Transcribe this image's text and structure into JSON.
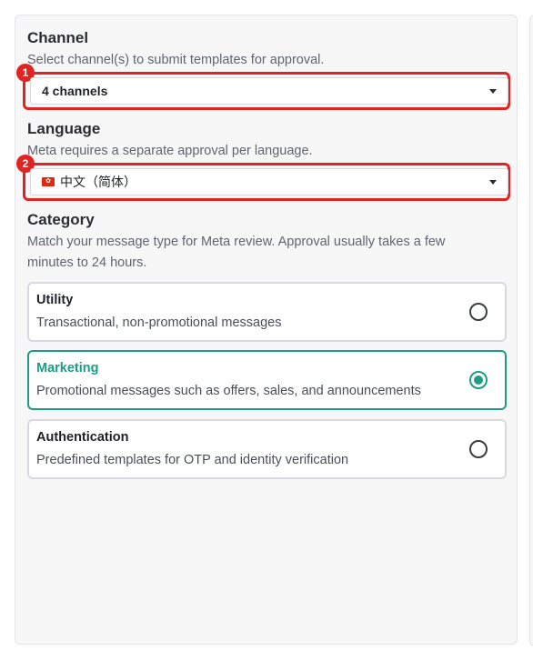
{
  "channel": {
    "title": "Channel",
    "description": "Select channel(s) to submit templates for approval.",
    "selected": "4 channels",
    "annotation": "1"
  },
  "language": {
    "title": "Language",
    "description": "Meta requires a separate approval per language.",
    "selected": "中文（简体）",
    "flag": "flag-icon",
    "annotation": "2"
  },
  "category": {
    "title": "Category",
    "description_line1": "Match your message type for Meta review. Approval usually takes a few",
    "description_line2": "minutes to 24 hours.",
    "options": [
      {
        "title": "Utility",
        "description": "Transactional, non-promotional messages",
        "selected": false
      },
      {
        "title": "Marketing",
        "description": "Promotional messages such as offers, sales, and announcements",
        "selected": true
      },
      {
        "title": "Authentication",
        "description": "Predefined templates for OTP and identity verification",
        "selected": false
      }
    ]
  },
  "colors": {
    "accent": "#1f9b86",
    "highlight": "#e02424"
  }
}
